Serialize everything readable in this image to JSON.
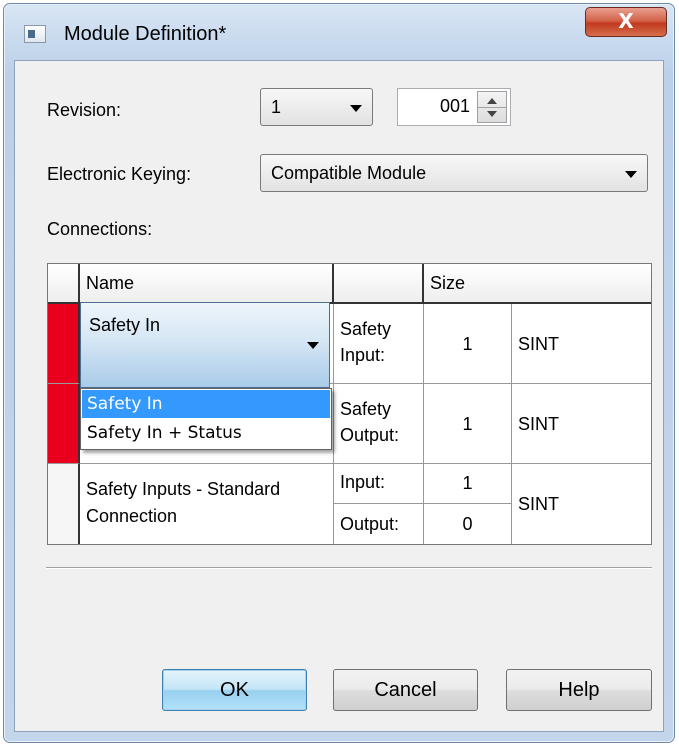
{
  "window": {
    "title": "Module Definition*",
    "close_label": "X"
  },
  "revision": {
    "label": "Revision:",
    "major": "1",
    "minor": "001"
  },
  "keying": {
    "label": "Electronic Keying:",
    "value": "Compatible Module"
  },
  "connections": {
    "label": "Connections:",
    "headers": {
      "name": "Name",
      "size": "Size"
    },
    "rows": [
      {
        "name": "Safety In",
        "direction": "Safety Input:",
        "size": "1",
        "type": "SINT",
        "marker_color": "#e8001c"
      },
      {
        "name": "Safety In",
        "direction": "Safety Output:",
        "size": "1",
        "type": "SINT",
        "marker_color": "#e8001c"
      },
      {
        "name": "Safety Inputs - Standard Connection",
        "input_label": "Input:",
        "input_size": "1",
        "output_label": "Output:",
        "output_size": "0",
        "type": "SINT"
      }
    ],
    "dropdown_options": [
      "Safety In",
      "Safety In + Status"
    ],
    "dropdown_selected": "Safety In"
  },
  "buttons": {
    "ok": "OK",
    "cancel": "Cancel",
    "help": "Help"
  }
}
